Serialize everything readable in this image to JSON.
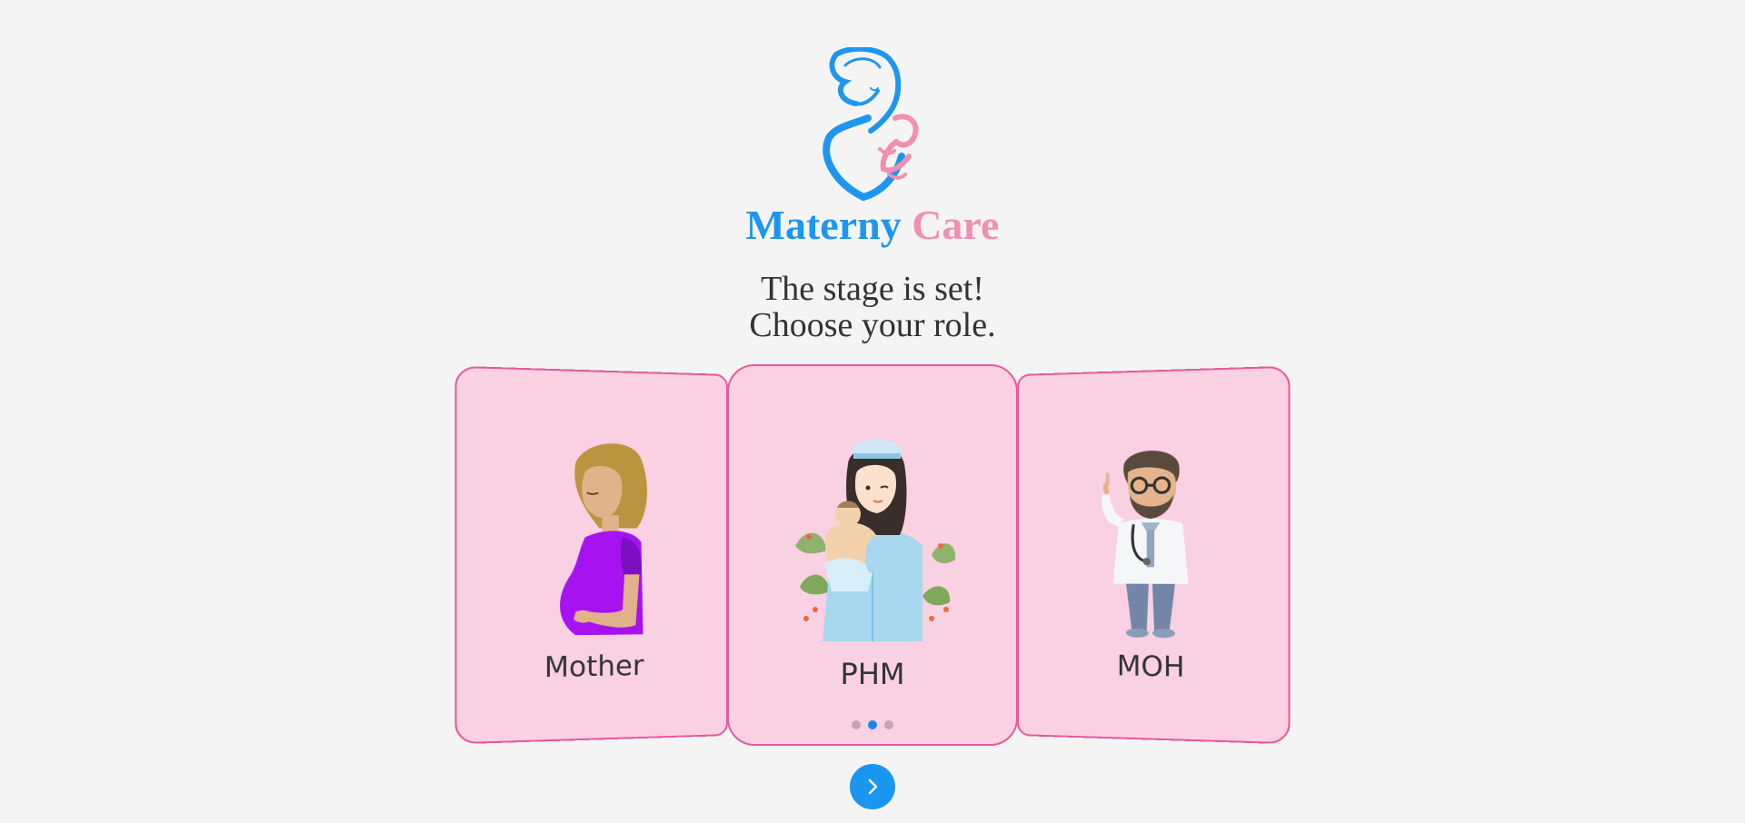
{
  "brand": {
    "part1": "Materny",
    "part2": "Care",
    "colors": {
      "primary": "#1e96f0",
      "secondary": "#f08fb0"
    }
  },
  "tagline": {
    "line1": "The stage is set!",
    "line2": "Choose your role."
  },
  "roles": [
    {
      "label": "Mother",
      "icon": "pregnant-mother-illustration"
    },
    {
      "label": "PHM",
      "icon": "nurse-with-baby-illustration"
    },
    {
      "label": "MOH",
      "icon": "doctor-illustration"
    }
  ],
  "carousel": {
    "active_index": 1,
    "dot_count": 3,
    "card_color": "#fad1e2",
    "card_border": "#e55a9b",
    "active_dot_color": "#1b84ea"
  },
  "next_button": {
    "icon": "chevron-right-icon",
    "color": "#1a96f0"
  }
}
